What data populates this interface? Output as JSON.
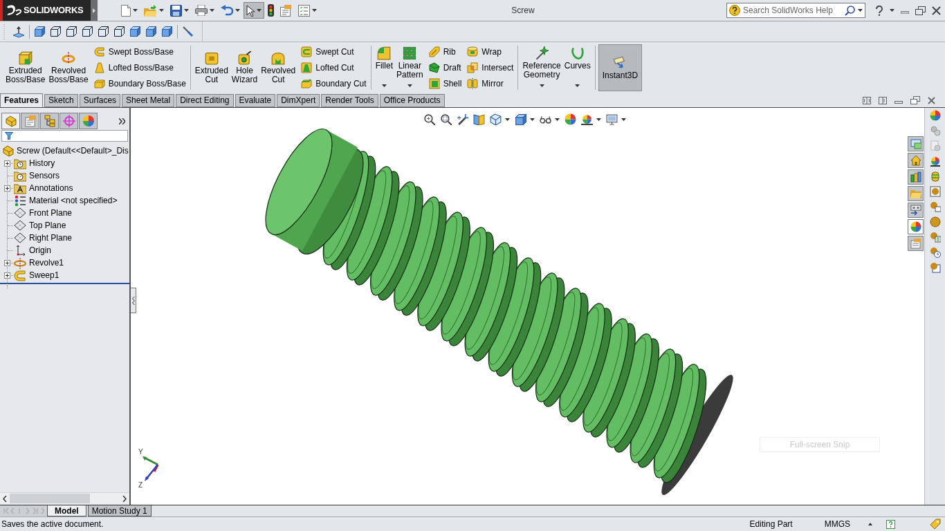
{
  "title_bar": {
    "logo_text": "SOLIDWORKS",
    "quick_access": [
      {
        "kind": "new",
        "pressed": false,
        "dropdown": true
      },
      {
        "kind": "open",
        "pressed": false,
        "dropdown": true
      },
      {
        "kind": "save",
        "pressed": false,
        "dropdown": true
      },
      {
        "kind": "print",
        "pressed": false,
        "dropdown": true
      },
      {
        "kind": "undo",
        "pressed": false,
        "dropdown": true
      },
      {
        "kind": "select",
        "pressed": true,
        "dropdown": true
      },
      {
        "kind": "rebuild",
        "pressed": false,
        "dropdown": false
      },
      {
        "kind": "properties",
        "pressed": false,
        "dropdown": false
      },
      {
        "kind": "options",
        "pressed": false,
        "dropdown": true
      }
    ],
    "title": "Screw",
    "search": {
      "placeholder": "Search SolidWorks Help"
    }
  },
  "command_manager": {
    "groups": [
      {
        "buttons": [
          {
            "kind": "extrude",
            "label": "Extruded Boss/Base",
            "pressed": false,
            "dropdown": false
          },
          {
            "kind": "revolve",
            "label": "Revolved Boss/Base",
            "pressed": false,
            "dropdown": false
          }
        ],
        "stacks": [
          [
            {
              "kind": "sweep",
              "label": "Swept Boss/Base",
              "pressed": false
            },
            {
              "kind": "loft",
              "label": "Lofted Boss/Base",
              "pressed": false
            },
            {
              "kind": "boundary",
              "label": "Boundary Boss/Base",
              "pressed": false
            }
          ]
        ]
      },
      {
        "buttons": [
          {
            "kind": "cut",
            "label": "Extruded Cut",
            "pressed": false,
            "dropdown": false
          },
          {
            "kind": "hole",
            "label": "Hole Wizard",
            "pressed": false,
            "dropdown": false
          },
          {
            "kind": "revolvecut",
            "label": "Revolved Cut",
            "pressed": false,
            "dropdown": false
          }
        ],
        "stacks": [
          [
            {
              "kind": "sweepcut",
              "label": "Swept Cut",
              "pressed": false
            },
            {
              "kind": "loftcut",
              "label": "Lofted Cut",
              "pressed": false
            },
            {
              "kind": "boundarycut",
              "label": "Boundary Cut",
              "pressed": false
            }
          ]
        ]
      },
      {
        "buttons": [
          {
            "kind": "fillet",
            "label": "Fillet",
            "pressed": false,
            "dropdown": true
          },
          {
            "kind": "pattern",
            "label": "Linear Pattern",
            "pressed": false,
            "dropdown": true
          }
        ],
        "stacks": [
          [
            {
              "kind": "rib",
              "label": "Rib",
              "pressed": false
            },
            {
              "kind": "draft",
              "label": "Draft",
              "pressed": false
            },
            {
              "kind": "shell",
              "label": "Shell",
              "pressed": false
            }
          ],
          [
            {
              "kind": "wrap",
              "label": "Wrap",
              "pressed": false
            },
            {
              "kind": "intersect",
              "label": "Intersect",
              "pressed": false
            },
            {
              "kind": "mirror",
              "label": "Mirror",
              "pressed": false
            }
          ]
        ]
      },
      {
        "buttons": [
          {
            "kind": "reference",
            "label": "Reference Geometry",
            "pressed": false,
            "dropdown": true
          },
          {
            "kind": "curves",
            "label": "Curves",
            "pressed": false,
            "dropdown": true
          }
        ]
      },
      {
        "buttons": [
          {
            "kind": "instant",
            "label": "Instant3D",
            "pressed": true,
            "dropdown": false
          }
        ]
      }
    ]
  },
  "command_tabs": [
    {
      "label": "Features",
      "selected": true
    },
    {
      "label": "Sketch",
      "selected": false
    },
    {
      "label": "Surfaces",
      "selected": false
    },
    {
      "label": "Sheet Metal",
      "selected": false
    },
    {
      "label": "Direct Editing",
      "selected": false
    },
    {
      "label": "Evaluate",
      "selected": false
    },
    {
      "label": "DimXpert",
      "selected": false
    },
    {
      "label": "Render Tools",
      "selected": false
    },
    {
      "label": "Office Products",
      "selected": false
    }
  ],
  "feature_manager": {
    "panel_tabs": [
      {
        "kind": "features",
        "selected": true
      },
      {
        "kind": "properties",
        "selected": false
      },
      {
        "kind": "configurations",
        "selected": false
      },
      {
        "kind": "dimxpert",
        "selected": false
      },
      {
        "kind": "display",
        "selected": false
      }
    ],
    "tree": {
      "label": "Screw (Default<<Default>_Dis",
      "children": [
        {
          "label": "History",
          "kind": "history",
          "expanded": false
        },
        {
          "label": "Sensors",
          "kind": "sensors"
        },
        {
          "label": "Annotations",
          "kind": "annotations",
          "expanded": false
        },
        {
          "label": "Material <not specified>",
          "kind": "material"
        },
        {
          "label": "Front Plane",
          "kind": "plane"
        },
        {
          "label": "Top Plane",
          "kind": "plane"
        },
        {
          "label": "Right Plane",
          "kind": "plane"
        },
        {
          "label": "Origin",
          "kind": "origin"
        },
        {
          "label": "Revolve1",
          "kind": "revolve",
          "expanded": false
        },
        {
          "label": "Sweep1",
          "kind": "sweep",
          "expanded": false
        }
      ]
    }
  },
  "viewport": {
    "task_tabs": [
      {
        "kind": "windows",
        "selected": false
      },
      {
        "kind": "home",
        "selected": false
      },
      {
        "kind": "library",
        "selected": false
      },
      {
        "kind": "folder",
        "selected": false
      },
      {
        "kind": "palette",
        "selected": false
      },
      {
        "kind": "appearances",
        "selected": true
      },
      {
        "kind": "properties",
        "selected": false
      }
    ],
    "triad_labels": [
      "Y",
      "Z"
    ],
    "snip_hint": "Full-screen Snip"
  },
  "bottom_tabs": [
    {
      "label": "Model",
      "selected": true
    },
    {
      "label": "Motion Study 1",
      "selected": false
    }
  ],
  "status_bar": {
    "message": "Saves the active document.",
    "mode": "Editing Part",
    "units": "MMGS"
  }
}
